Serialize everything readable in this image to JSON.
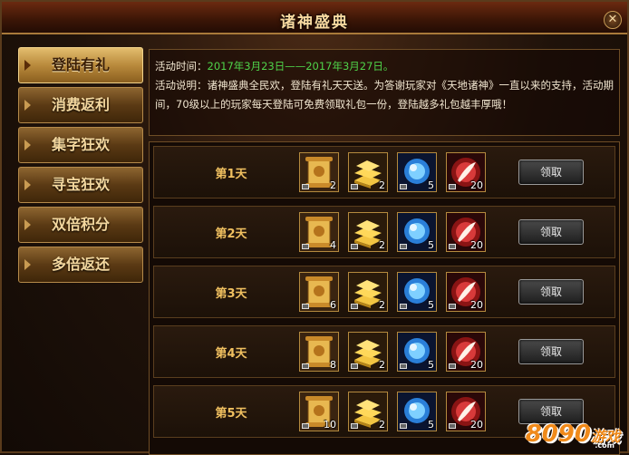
{
  "window": {
    "title": "诸神盛典",
    "close_label": "✕"
  },
  "sidebar": {
    "items": [
      {
        "label": "登陆有礼",
        "active": true
      },
      {
        "label": "消费返利"
      },
      {
        "label": "集字狂欢"
      },
      {
        "label": "寻宝狂欢"
      },
      {
        "label": "双倍积分"
      },
      {
        "label": "多倍返还"
      }
    ]
  },
  "info": {
    "time_label": "活动时间：",
    "time_value": "2017年3月23日——2017年3月27日。",
    "desc": "活动说明：诸神盛典全民欢，登陆有礼天天送。为答谢玩家对《天地诸神》一直以来的支持，活动期间，70级以上的玩家每天登陆可免费领取礼包一份，登陆越多礼包越丰厚哦！"
  },
  "rows": [
    {
      "day": "第1天",
      "counts": [
        "2",
        "2",
        "5",
        "20"
      ],
      "claim": "领取"
    },
    {
      "day": "第2天",
      "counts": [
        "4",
        "2",
        "5",
        "20"
      ],
      "claim": "领取"
    },
    {
      "day": "第3天",
      "counts": [
        "6",
        "2",
        "5",
        "20"
      ],
      "claim": "领取"
    },
    {
      "day": "第4天",
      "counts": [
        "8",
        "2",
        "5",
        "20"
      ],
      "claim": "领取"
    },
    {
      "day": "第5天",
      "counts": [
        "10",
        "2",
        "5",
        "20"
      ],
      "claim": "领取"
    }
  ],
  "item_icons": [
    "scroll-icon",
    "gold-bars-icon",
    "blue-orb-icon",
    "red-feather-icon"
  ],
  "watermark": {
    "main": "8090",
    "suffix": "游戏",
    "domain": ".com"
  },
  "colors": {
    "accent_gold": "#f0c060",
    "date_green": "#4fd34a",
    "watermark_orange": "#f08a1a"
  }
}
